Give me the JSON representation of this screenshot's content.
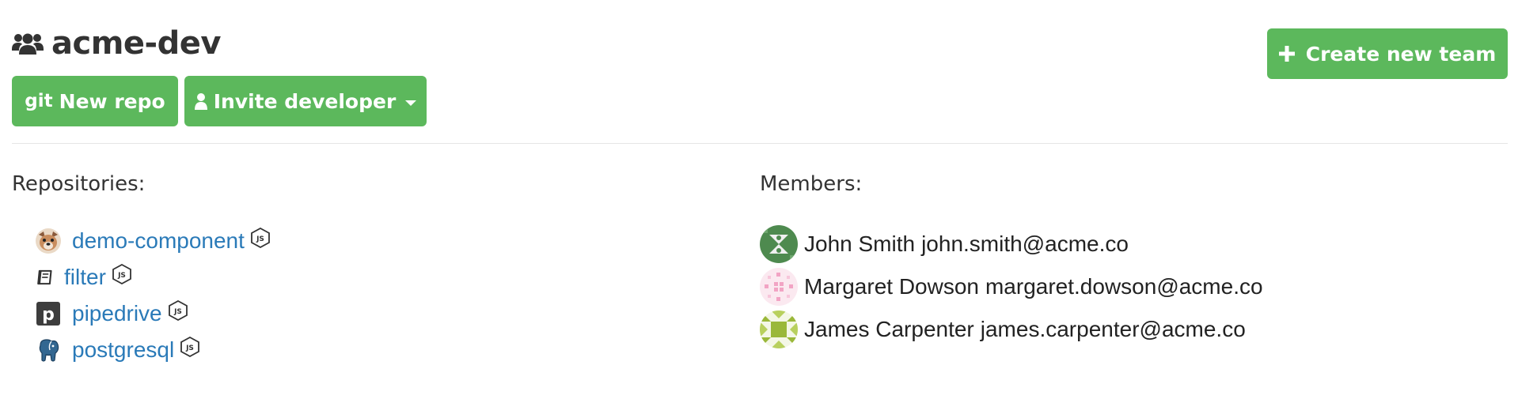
{
  "team": {
    "name": "acme-dev",
    "icon": "users-icon"
  },
  "toolbar": {
    "new_repo_prefix": "git",
    "new_repo_label": "New repo",
    "invite_label": "Invite developer",
    "invite_icon": "user-icon",
    "create_team_label": "Create new team",
    "create_team_icon": "plus-icon"
  },
  "colors": {
    "accent_green": "#5cb85c",
    "link_blue": "#2a7ab8",
    "text_dark": "#333333"
  },
  "repositories": {
    "heading": "Repositories:",
    "items": [
      {
        "name": "demo-component",
        "avatar": "dog-avatar-icon",
        "badge": "nodejs-icon"
      },
      {
        "name": "filter",
        "avatar": "book-icon",
        "badge": "nodejs-icon"
      },
      {
        "name": "pipedrive",
        "avatar": "pipedrive-logo-icon",
        "badge": "nodejs-icon"
      },
      {
        "name": "postgresql",
        "avatar": "postgresql-elephant-icon",
        "badge": "nodejs-icon"
      }
    ]
  },
  "members": {
    "heading": "Members:",
    "items": [
      {
        "name": "John Smith",
        "email": "john.smith@acme.co",
        "avatar": "identicon-green"
      },
      {
        "name": "Margaret Dowson",
        "email": "margaret.dowson@acme.co",
        "avatar": "identicon-pink"
      },
      {
        "name": "James Carpenter",
        "email": "james.carpenter@acme.co",
        "avatar": "identicon-olive"
      }
    ]
  }
}
